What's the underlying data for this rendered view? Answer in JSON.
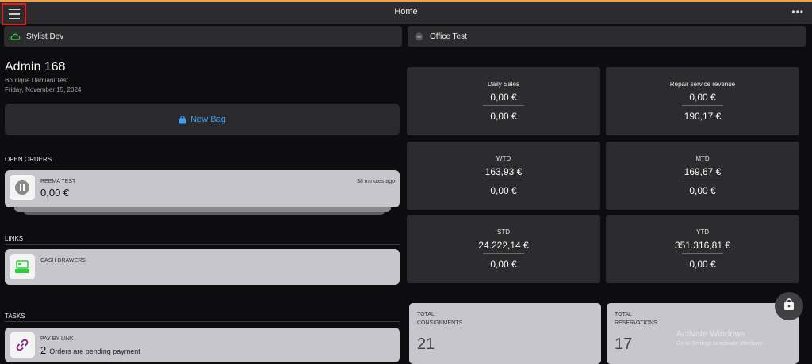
{
  "header": {
    "title": "Home",
    "menu_icon": "hamburger-menu-icon",
    "more_label": "•••"
  },
  "stores": {
    "left_label": "Stylist Dev",
    "right_label": "Office Test"
  },
  "user": {
    "name": "Admin 168",
    "boutique": "Boutique Damiani Test",
    "date": "Friday, November 15, 2024"
  },
  "new_bag_label": "New Bag",
  "sections": {
    "open_orders": "OPEN ORDERS",
    "links": "LINKS",
    "tasks": "TASKS"
  },
  "open_order": {
    "customer": "REEMA TEST",
    "amount": "0,00 €",
    "time": "38 minutes ago"
  },
  "links": {
    "cash_drawers": "CASH DRAWERS"
  },
  "task": {
    "title": "PAY BY LINK",
    "count": "2",
    "description": "Orders are pending payment"
  },
  "kpis": [
    {
      "title": "Daily Sales",
      "v1": "0,00 €",
      "v2": "0,00 €"
    },
    {
      "title": "Repair service revenue",
      "v1": "0,00 €",
      "v2": "190,17 €"
    },
    {
      "title": "WTD",
      "v1": "163,93 €",
      "v2": "0,00 €"
    },
    {
      "title": "MTD",
      "v1": "169,67 €",
      "v2": "0,00 €"
    },
    {
      "title": "STD",
      "v1": "24.222,14 €",
      "v2": "0,00 €"
    },
    {
      "title": "YTD",
      "v1": "351.316,81 €",
      "v2": "0,00 €"
    }
  ],
  "totals": {
    "consignments": {
      "line1": "TOTAL",
      "line2": "CONSIGNMENTS",
      "value": "21"
    },
    "reservations": {
      "line1": "TOTAL",
      "line2": "RESERVATIONS",
      "value": "17"
    }
  },
  "watermark": {
    "line1": "Activate Windows",
    "line2": "Go to Settings to activate Windows."
  },
  "colors": {
    "accent": "#3a9cf2",
    "top_border": "#f0a040",
    "cash_icon": "#2ecc40",
    "link_icon": "#8a1a8a"
  }
}
